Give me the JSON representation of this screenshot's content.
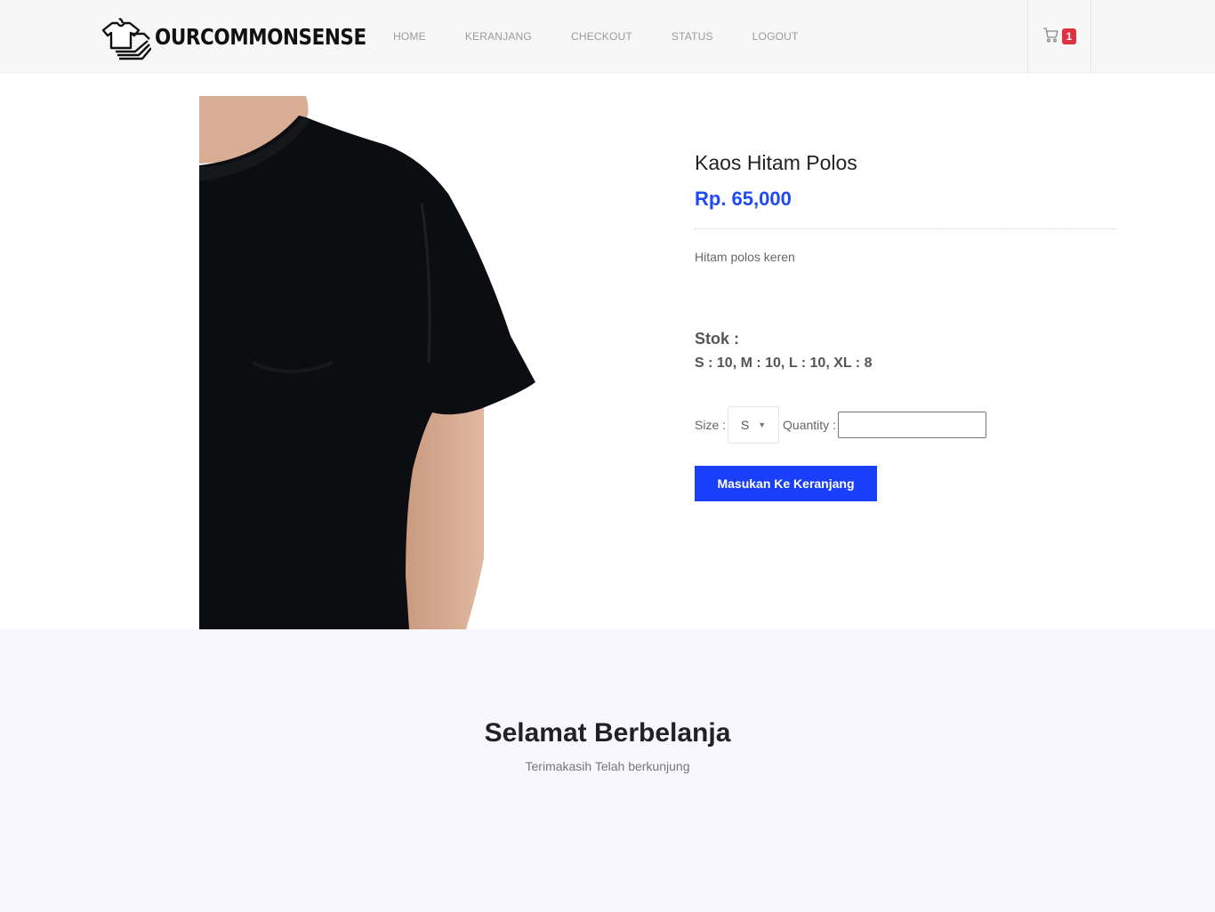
{
  "brand": {
    "name": "OURCOMMONSENSE",
    "logo_icon": "tshirt-stack-icon"
  },
  "nav": {
    "items": [
      {
        "label": "HOME"
      },
      {
        "label": "KERANJANG"
      },
      {
        "label": "CHECKOUT"
      },
      {
        "label": "STATUS"
      },
      {
        "label": "LOGOUT"
      }
    ]
  },
  "cart": {
    "icon": "cart-icon",
    "count": "1",
    "badge_color": "#e0313f"
  },
  "product": {
    "image_icon": "black-tshirt-photo",
    "title": "Kaos Hitam Polos",
    "price": "Rp. 65,000",
    "price_color": "#1f4af0",
    "description": "Hitam polos keren",
    "stock_label": "Stok :",
    "stock_values": "S : 10, M : 10, L : 10, XL : 8"
  },
  "form": {
    "size_label": "Size :",
    "size_selected": "S",
    "quantity_label": "Quantity :",
    "quantity_value": ""
  },
  "actions": {
    "add_to_cart": "Masukan Ke Keranjang",
    "button_color": "#1a3ffb"
  },
  "footer": {
    "title": "Selamat Berbelanja",
    "subtitle": "Terimakasih Telah berkunjung"
  }
}
